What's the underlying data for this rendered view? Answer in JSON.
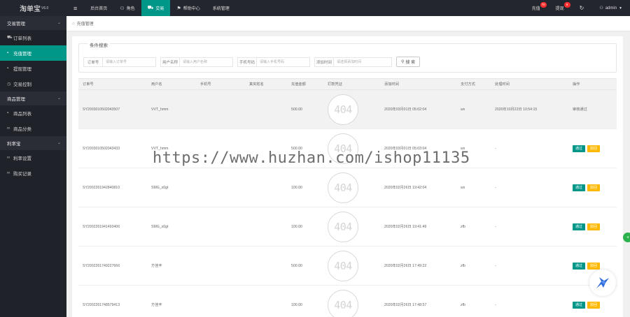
{
  "brand": {
    "name": "淘单宝",
    "version": "V6.0"
  },
  "top_nav": [
    {
      "label": "后台首页",
      "icon": ""
    },
    {
      "label": "角色",
      "icon": "user-icon"
    },
    {
      "label": "交易",
      "icon": "cart-icon"
    },
    {
      "label": "帮助中心",
      "icon": "flag-icon"
    },
    {
      "label": "系统管理",
      "icon": ""
    }
  ],
  "top_right": {
    "recharge_label": "充值",
    "recharge_badge": "70",
    "withdraw_label": "提现",
    "withdraw_badge": "6",
    "user": "admin"
  },
  "sidebar": {
    "groups": [
      {
        "title": "交易管理",
        "items": [
          {
            "label": "订单列表",
            "icon": "cart-icon"
          },
          {
            "label": "充值管理",
            "icon": "list-icon"
          },
          {
            "label": "提现管理",
            "icon": "list-icon"
          },
          {
            "label": "交易控制",
            "icon": "clock-icon"
          }
        ]
      },
      {
        "title": "商品管理",
        "items": [
          {
            "label": "商品列表",
            "icon": "list-icon"
          },
          {
            "label": "商品分类",
            "icon": "link-icon"
          }
        ]
      },
      {
        "title": "利率宝",
        "items": [
          {
            "label": "利率设置",
            "icon": "link-icon"
          },
          {
            "label": "购买记录",
            "icon": "link-icon"
          }
        ]
      }
    ]
  },
  "breadcrumb": {
    "label": "充值管理"
  },
  "search": {
    "legend": "条件搜索",
    "fields": [
      {
        "label": "订单号",
        "placeholder": "请输入订单号"
      },
      {
        "label": "用户名称",
        "placeholder": "请输入用户名称"
      },
      {
        "label": "手机号码",
        "placeholder": "请输入手机号码"
      },
      {
        "label": "添加时间",
        "placeholder": "请选择添加时间"
      }
    ],
    "button_label": "搜 索"
  },
  "table": {
    "headers": [
      "订单号",
      "用户名",
      "手机号",
      "真实姓名",
      "充值金额",
      "打款凭证",
      "添加时间",
      "支付方式",
      "处理时间",
      "操作"
    ],
    "proof_text": "404",
    "pass_label": "通过",
    "reject_label": "驳回",
    "rows": [
      {
        "order": "SY2003010502043507",
        "user": "VVT_hmm",
        "phone": "",
        "realname": "",
        "amount": "500.00",
        "time": "2020年03月01日 05:02:04",
        "pay": "wx",
        "processed": "2020年10月22日 10:54:15",
        "op": "审核通过"
      },
      {
        "order": "SY2003010502043433",
        "user": "VVT_hmm",
        "phone": "",
        "realname": "",
        "amount": "500.00",
        "time": "2020年03月01日 05:03:04",
        "pay": "wx",
        "processed": "-",
        "op": ""
      },
      {
        "order": "SY2002261942840810",
        "user": "SMG_x0gt",
        "phone": "",
        "realname": "",
        "amount": "100.00",
        "time": "2020年02月26日 19:42:04",
        "pay": "wx",
        "processed": "-",
        "op": ""
      },
      {
        "order": "SY2002261941493406",
        "user": "SMG_x0gt",
        "phone": "",
        "realname": "",
        "amount": "100.00",
        "time": "2020年02月26日 19:41:49",
        "pay": "zfb",
        "processed": "-",
        "op": ""
      },
      {
        "order": "SY2002261749227666",
        "user": "方佳丰",
        "phone": "",
        "realname": "",
        "amount": "500.00",
        "time": "2020年02月26日 17:49:22",
        "pay": "zfb",
        "processed": "-",
        "op": ""
      },
      {
        "order": "SY2002261748579413",
        "user": "方佳丰",
        "phone": "",
        "realname": "",
        "amount": "100.00",
        "time": "2020年02月26日 17:48:57",
        "pay": "zfb",
        "processed": "-",
        "op": ""
      }
    ]
  },
  "watermark": "https://www.huzhan.com/ishop11135",
  "colors": {
    "accent": "#009688",
    "topbar": "#23262e",
    "sidebar": "#20222a",
    "warn": "#ffb800",
    "badge": "#ff2d2d"
  }
}
